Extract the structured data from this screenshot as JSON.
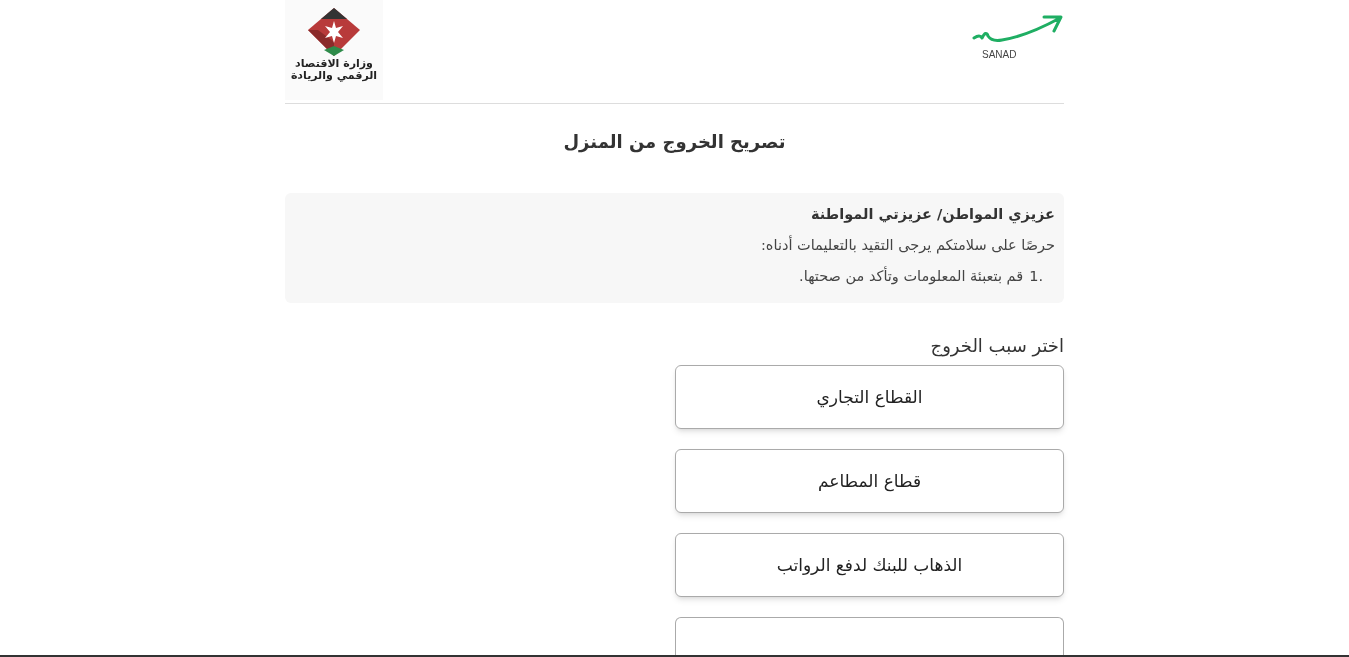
{
  "header": {
    "ministry_logo_text": [
      "وزارة الاقتصاد",
      "الرقمي والريادة"
    ],
    "sanad_logo_text": "SANAD"
  },
  "title": "تصريح الخروج من المنزل",
  "notice": {
    "heading": "عزيزي المواطن/ عزيزتي المواطنة",
    "intro": "حرصًا على سلامتكم يرجى التقيد بالتعليمات أدناه:",
    "items": [
      {
        "marker": "1.",
        "text": "قم بتعبئة المعلومات وتأكد من صحتها."
      }
    ]
  },
  "reason_label": "اختر سبب الخروج",
  "reasons": [
    {
      "label": "القطاع التجاري"
    },
    {
      "label": "قطاع المطاعم"
    },
    {
      "label": "الذهاب للبنك لدفع الرواتب"
    },
    {
      "kind": "cut"
    }
  ]
}
